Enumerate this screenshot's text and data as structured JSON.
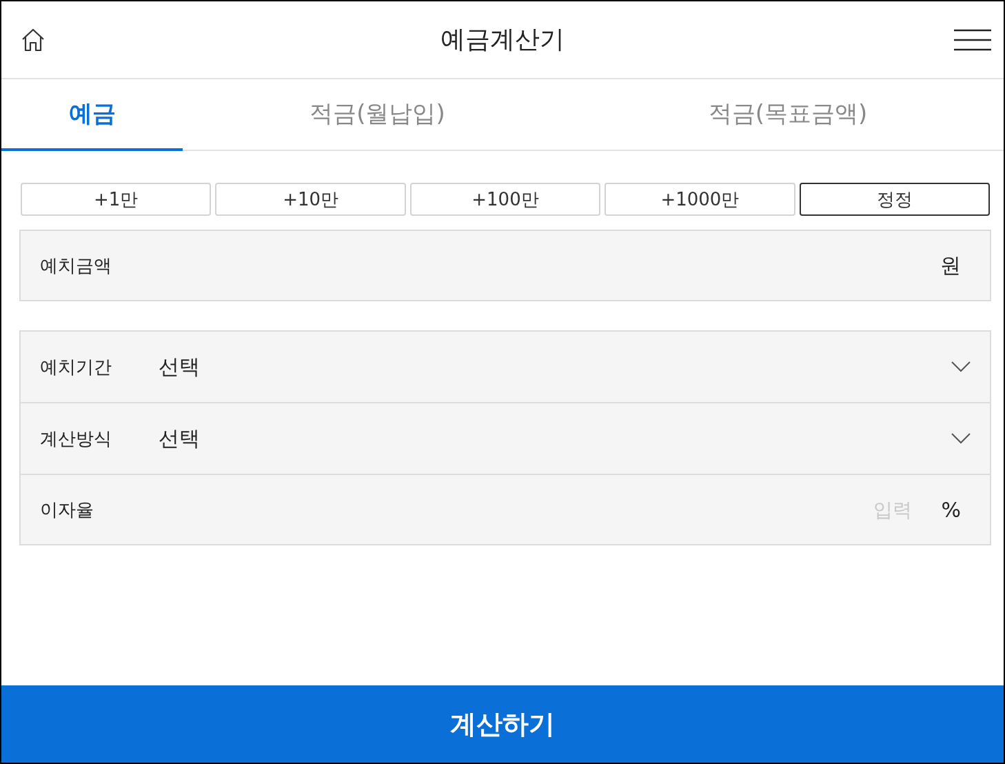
{
  "header": {
    "title": "예금계산기"
  },
  "tabs": [
    {
      "label": "예금",
      "selected": true
    },
    {
      "label": "적금(월납입)",
      "selected": false
    },
    {
      "label": "적금(목표금액)",
      "selected": false
    }
  ],
  "quick_buttons": [
    {
      "label": "+1만",
      "kind": "add"
    },
    {
      "label": "+10만",
      "kind": "add"
    },
    {
      "label": "+100만",
      "kind": "add"
    },
    {
      "label": "+1000만",
      "kind": "add"
    },
    {
      "label": "정정",
      "kind": "reset"
    }
  ],
  "amount": {
    "label": "예치금액",
    "unit": "원"
  },
  "options": [
    {
      "kind": "select",
      "label": "예치기간",
      "value": "선택"
    },
    {
      "kind": "select",
      "label": "계산방식",
      "value": "선택"
    },
    {
      "kind": "input",
      "label": "이자율",
      "placeholder": "입력",
      "unit": "%"
    }
  ],
  "submit": {
    "label": "계산하기"
  }
}
